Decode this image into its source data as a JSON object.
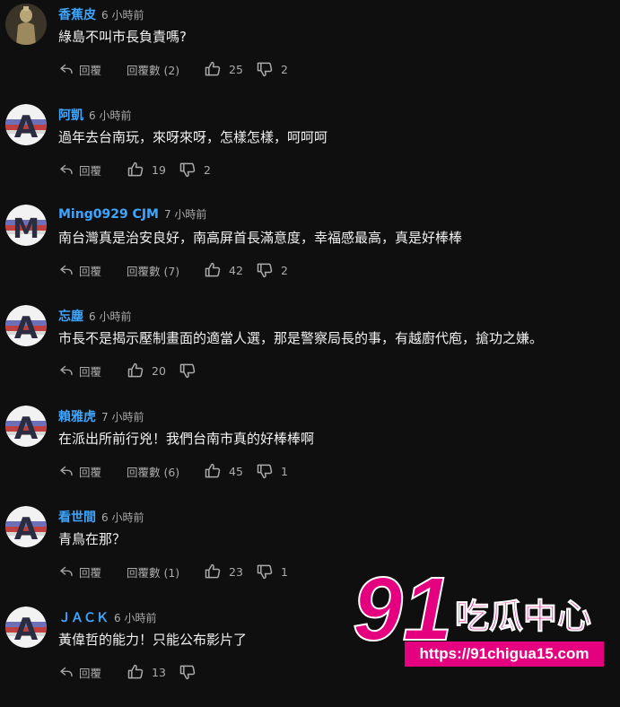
{
  "colors": {
    "background": "#0f0f0f",
    "username": "#3ea6ff",
    "text": "#f1f1f1",
    "meta": "#aaaaaa",
    "watermark_pink": "#e4007f"
  },
  "comments": [
    {
      "avatar": "statue-avatar",
      "name": "香蕉皮",
      "time": "6 小時前",
      "text": "綠島不叫市長負責嗎?",
      "reply_label": "回覆",
      "replies_label": "回覆數 (2)",
      "likes": "25",
      "dislikes": "2"
    },
    {
      "avatar": "letter-avatar",
      "avatar_letter": "A",
      "name": "阿凱",
      "time": "6 小時前",
      "text": "過年去台南玩，來呀來呀，怎樣怎樣，呵呵呵",
      "reply_label": "回覆",
      "likes": "19",
      "dislikes": "2"
    },
    {
      "avatar": "letter-avatar",
      "avatar_letter": "M",
      "name": "Ming0929 CJM",
      "time": "7 小時前",
      "text": "南台灣真是治安良好，南高屏首長滿意度，幸福感最高，真是好棒棒",
      "reply_label": "回覆",
      "replies_label": "回覆數 (7)",
      "likes": "42",
      "dislikes": "2"
    },
    {
      "avatar": "letter-avatar",
      "avatar_letter": "A",
      "name": "忘塵",
      "time": "6 小時前",
      "text": "市長不是揭示壓制畫面的適當人選，那是警察局長的事，有越廚代庖，搶功之嫌。",
      "reply_label": "回覆",
      "likes": "20"
    },
    {
      "avatar": "letter-avatar",
      "avatar_letter": "A",
      "name": "賴雅虎",
      "time": "7 小時前",
      "text": "在派出所前行兇！我們台南市真的好棒棒啊",
      "reply_label": "回覆",
      "replies_label": "回覆數 (6)",
      "likes": "45",
      "dislikes": "1"
    },
    {
      "avatar": "letter-avatar",
      "avatar_letter": "A",
      "name": "看世間",
      "time": "6 小時前",
      "text": "青鳥在那？",
      "reply_label": "回覆",
      "replies_label": "回覆數 (1)",
      "likes": "23",
      "dislikes": "1"
    },
    {
      "avatar": "letter-avatar",
      "avatar_letter": "A",
      "name": "ＪＡＣＫ",
      "time": "6 小時前",
      "text": "黃偉哲的能力！只能公布影片了",
      "reply_label": "回覆",
      "likes": "13"
    }
  ],
  "watermark": {
    "logo_number": "91",
    "logo_text": "吃瓜中心",
    "url": "https://91chigua15.com"
  }
}
